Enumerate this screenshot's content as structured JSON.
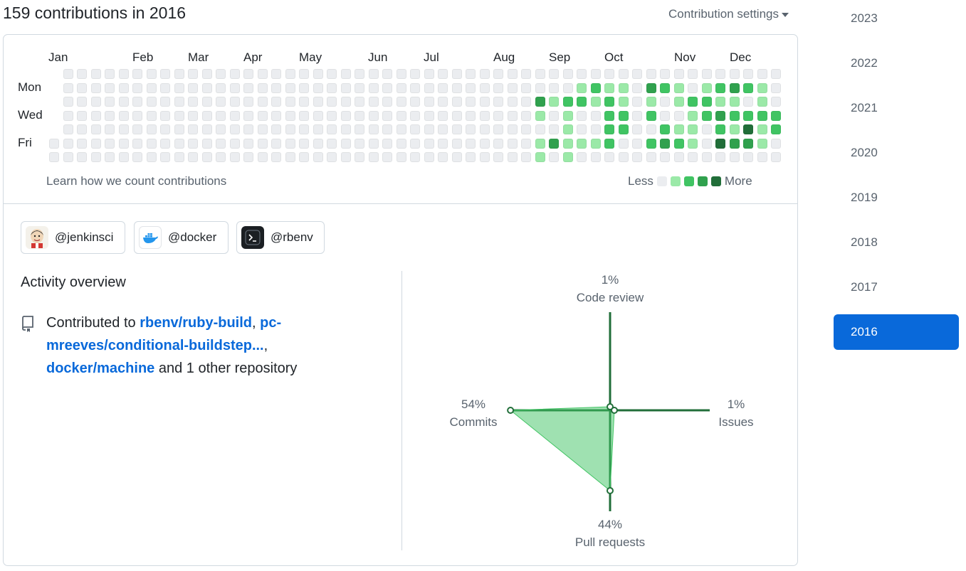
{
  "header": {
    "title": "159 contributions in 2016",
    "settings_label": "Contribution settings"
  },
  "calendar": {
    "months": [
      "Jan",
      "Feb",
      "Mar",
      "Apr",
      "May",
      "Jun",
      "Jul",
      "Aug",
      "Sep",
      "Oct",
      "Nov",
      "Dec"
    ],
    "weekday_labels": [
      "Mon",
      "Wed",
      "Fri"
    ],
    "learn_link": "Learn how we count contributions",
    "legend_less": "Less",
    "legend_more": "More",
    "level_colors": [
      "#ebedf0",
      "#9be9a8",
      "#40c463",
      "#30a14e",
      "#216e39"
    ],
    "week_count": 53,
    "first_week_start_day": 5,
    "last_week_end_day": 6,
    "levels_by_week": {
      "37": [
        0,
        0,
        3,
        1,
        0,
        1,
        1
      ],
      "38": [
        0,
        0,
        1,
        0,
        0,
        3,
        0
      ],
      "39": [
        0,
        0,
        2,
        1,
        1,
        1,
        1
      ],
      "40": [
        0,
        1,
        2,
        0,
        0,
        1,
        0
      ],
      "41": [
        0,
        2,
        1,
        0,
        0,
        1,
        0
      ],
      "42": [
        0,
        1,
        2,
        2,
        2,
        2,
        0
      ],
      "43": [
        0,
        1,
        1,
        2,
        2,
        0,
        0
      ],
      "44": [
        0,
        0,
        0,
        0,
        0,
        0,
        0
      ],
      "45": [
        0,
        3,
        1,
        2,
        0,
        2,
        0
      ],
      "46": [
        0,
        2,
        0,
        0,
        2,
        3,
        0
      ],
      "47": [
        0,
        1,
        1,
        0,
        1,
        2,
        0
      ],
      "48": [
        0,
        0,
        2,
        1,
        1,
        1,
        0
      ],
      "49": [
        0,
        1,
        2,
        2,
        0,
        0,
        0
      ],
      "50": [
        0,
        2,
        1,
        3,
        2,
        4,
        0
      ],
      "51": [
        0,
        3,
        1,
        2,
        1,
        3,
        0
      ],
      "52": [
        0,
        2,
        0,
        2,
        4,
        3,
        0
      ],
      "53": [
        0,
        1,
        1,
        2,
        1,
        1,
        0
      ],
      "54": [
        0,
        0,
        0,
        2,
        2,
        0,
        0
      ]
    }
  },
  "orgs": [
    {
      "handle": "@jenkinsci",
      "avatar": "jenkins-avatar"
    },
    {
      "handle": "@docker",
      "avatar": "docker-avatar"
    },
    {
      "handle": "@rbenv",
      "avatar": "rbenv-avatar"
    }
  ],
  "activity": {
    "title": "Activity overview",
    "prefix": "Contributed to",
    "repo1": "rbenv/ruby-build",
    "sep1": ",",
    "repo2": "pc-mreeves/conditional-buildstep...",
    "sep2": ",",
    "repo3": "docker/machine",
    "suffix": "and 1 other repository"
  },
  "radar": {
    "code_review": {
      "pct": "1%",
      "label": "Code review",
      "value": 1
    },
    "issues": {
      "pct": "1%",
      "label": "Issues",
      "value": 1
    },
    "pull_requests": {
      "pct": "44%",
      "label": "Pull requests",
      "value": 44
    },
    "commits": {
      "pct": "54%",
      "label": "Commits",
      "value": 54
    },
    "line_color": "#216e39",
    "fill_color": "#40c463"
  },
  "years": [
    "2023",
    "2022",
    "2021",
    "2020",
    "2019",
    "2018",
    "2017",
    "2016"
  ],
  "selected_year": "2016",
  "accent": "#0969da"
}
